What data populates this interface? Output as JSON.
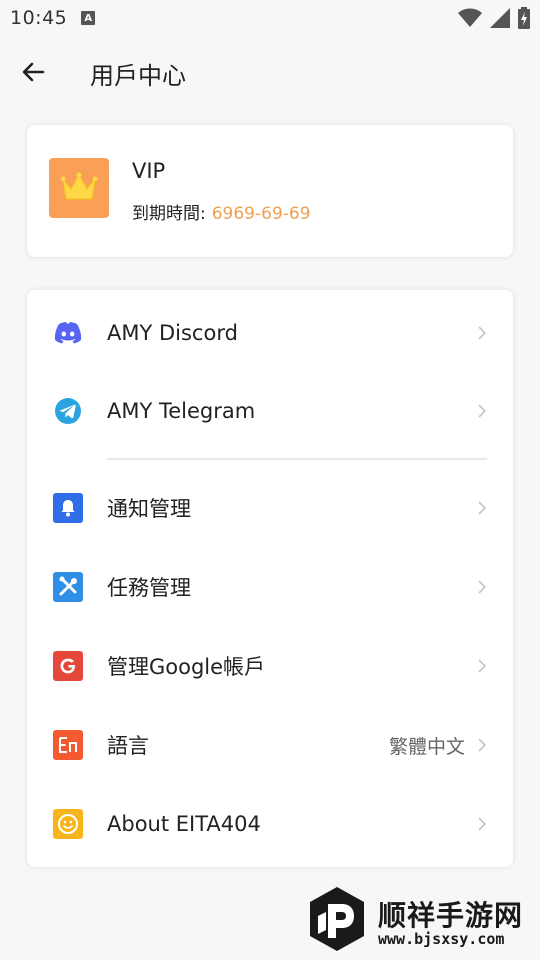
{
  "status_bar": {
    "time": "10:45",
    "notification_icon_letter": "A",
    "icons": [
      "wifi-icon",
      "signal-icon",
      "battery-charging-icon"
    ]
  },
  "header": {
    "title": "用戶中心",
    "back_icon": "arrow-left-icon"
  },
  "vip": {
    "title": "VIP",
    "expire_label": "到期時間:",
    "expire_date": "6969-69-69",
    "badge_icon": "crown-icon",
    "badge_color": "#f9a056",
    "date_color": "#f0a050"
  },
  "menu": {
    "items": [
      {
        "label": "AMY Discord",
        "icon": "discord-icon",
        "icon_color": "#5865f2"
      },
      {
        "label": "AMY Telegram",
        "icon": "telegram-icon",
        "icon_color": "#2aa3e0"
      },
      {
        "label": "通知管理",
        "icon": "bell-icon",
        "icon_color": "#2f6ee6"
      },
      {
        "label": "任務管理",
        "icon": "tools-icon",
        "icon_color": "#2f8fe6"
      },
      {
        "label": "管理Google帳戶",
        "icon": "google-icon",
        "icon_color": "#e5483a"
      },
      {
        "label": "語言",
        "value": "繁體中文",
        "icon": "language-icon",
        "icon_color": "#f35a30"
      },
      {
        "label": "About EITA404",
        "icon": "smiley-icon",
        "icon_color": "#f7b51c"
      }
    ]
  },
  "watermark": {
    "name": "顺祥手游网",
    "url": "www.bjsxsy.com"
  }
}
